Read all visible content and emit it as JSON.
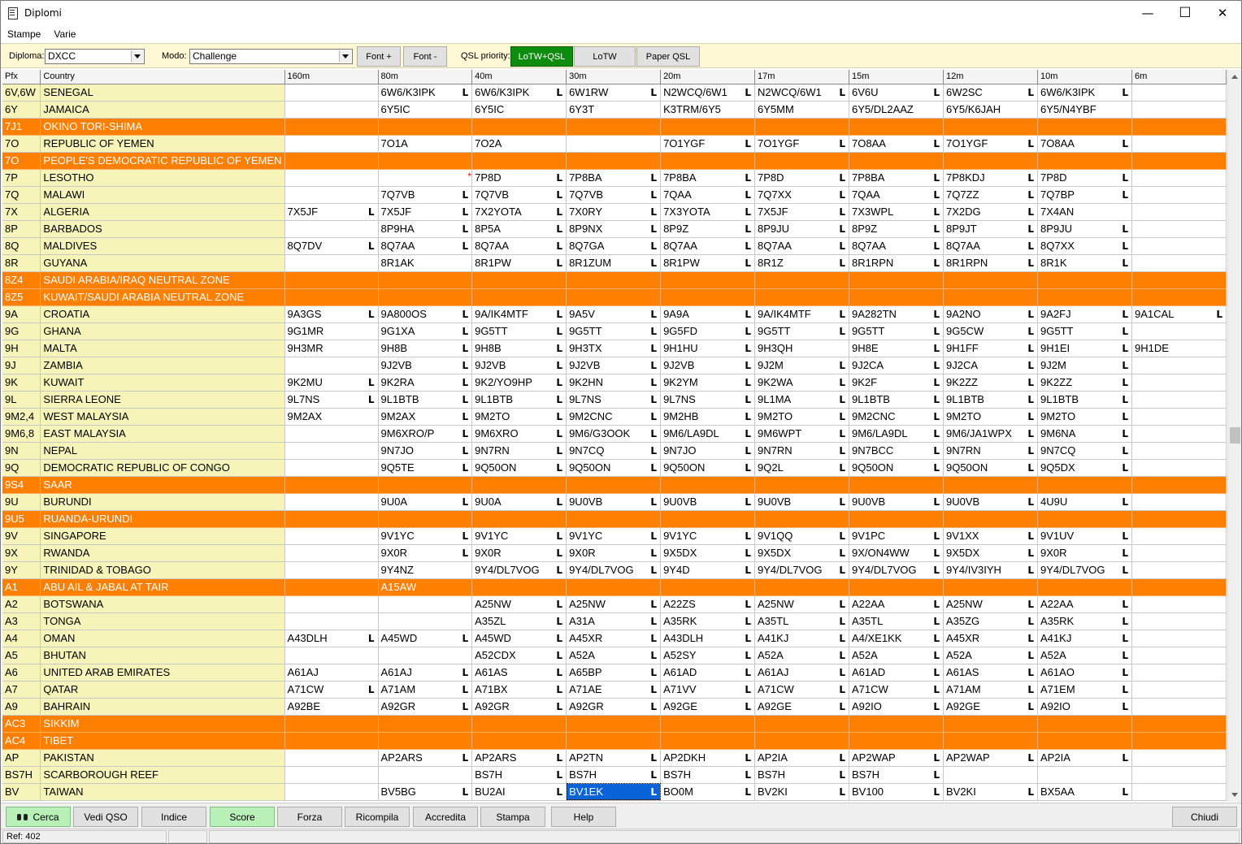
{
  "window": {
    "title": "Diplomi",
    "minimize": "—",
    "maximize": "☐",
    "close": "✕"
  },
  "menu": [
    "Stampe",
    "Varie"
  ],
  "toolbar": {
    "diploma_label": "Diploma:",
    "diploma_value": "DXCC",
    "modo_label": "Modo:",
    "modo_value": "Challenge",
    "font_plus": "Font +",
    "font_minus": "Font -",
    "qsl_label": "QSL priority:",
    "qsl_buttons": [
      "LoTW+QSL",
      "LoTW",
      "Paper QSL"
    ],
    "qsl_active": "LoTW+QSL"
  },
  "grid": {
    "columns": [
      "Pfx",
      "Country",
      "160m",
      "80m",
      "40m",
      "30m",
      "20m",
      "17m",
      "15m",
      "12m",
      "10m",
      "6m"
    ],
    "rows": [
      {
        "pfx": "6V,6W",
        "country": "SENEGAL",
        "cells": [
          "",
          "6W6/K3IPK|L",
          "6W6/K3IPK|L",
          "6W1RW|L",
          "N2WCQ/6W1|L",
          "N2WCQ/6W1|L",
          "6V6U|L",
          "6W2SC|L",
          "6W6/K3IPK|L",
          ""
        ]
      },
      {
        "pfx": "6Y",
        "country": "JAMAICA",
        "cells": [
          "",
          "6Y5IC",
          "6Y5IC",
          "6Y3T",
          "K3TRM/6Y5",
          "6Y5MM",
          "6Y5/DL2AAZ",
          "6Y5/K6JAH",
          "6Y5/N4YBF",
          ""
        ]
      },
      {
        "pfx": "7J1",
        "country": "OKINO TORI-SHIMA",
        "deleted": true,
        "cells": [
          "",
          "",
          "",
          "",
          "",
          "",
          "",
          "",
          "",
          ""
        ]
      },
      {
        "pfx": "7O",
        "country": "REPUBLIC OF YEMEN",
        "cells": [
          "",
          "7O1A",
          "7O2A",
          "",
          "7O1YGF|L",
          "7O1YGF|L",
          "7O8AA|L",
          "7O1YGF|L",
          "7O8AA|L",
          ""
        ]
      },
      {
        "pfx": "7O",
        "country": "PEOPLE'S DEMOCRATIC REPUBLIC OF YEMEN",
        "deleted": true,
        "cells": [
          "",
          "",
          "",
          "",
          "",
          "",
          "",
          "",
          "",
          ""
        ]
      },
      {
        "pfx": "7P",
        "country": "LESOTHO",
        "cells": [
          "",
          "|*",
          "7P8D|L",
          "7P8BA|L",
          "7P8BA|L",
          "7P8D|L",
          "7P8BA|L",
          "7P8KDJ|L",
          "7P8D|L",
          ""
        ]
      },
      {
        "pfx": "7Q",
        "country": "MALAWI",
        "cells": [
          "",
          "7Q7VB|L",
          "7Q7VB|L",
          "7Q7VB|L",
          "7QAA|L",
          "7Q7XX|L",
          "7QAA|L",
          "7Q7ZZ|L",
          "7Q7BP|L",
          ""
        ]
      },
      {
        "pfx": "7X",
        "country": "ALGERIA",
        "cells": [
          "7X5JF|L",
          "7X5JF|L",
          "7X2YOTA|L",
          "7X0RY|L",
          "7X3YOTA|L",
          "7X5JF|L",
          "7X3WPL|L",
          "7X2DG|L",
          "7X4AN",
          ""
        ]
      },
      {
        "pfx": "8P",
        "country": "BARBADOS",
        "cells": [
          "",
          "8P9HA|L",
          "8P5A|L",
          "8P9NX|L",
          "8P9Z|L",
          "8P9JU|L",
          "8P9Z|L",
          "8P9JT|L",
          "8P9JU|L",
          ""
        ]
      },
      {
        "pfx": "8Q",
        "country": "MALDIVES",
        "cells": [
          "8Q7DV|L",
          "8Q7AA|L",
          "8Q7AA|L",
          "8Q7GA|L",
          "8Q7AA|L",
          "8Q7AA|L",
          "8Q7AA|L",
          "8Q7AA|L",
          "8Q7XX|L",
          ""
        ]
      },
      {
        "pfx": "8R",
        "country": "GUYANA",
        "cells": [
          "",
          "8R1AK",
          "8R1PW|L",
          "8R1ZUM|L",
          "8R1PW|L",
          "8R1Z|L",
          "8R1RPN|L",
          "8R1RPN|L",
          "8R1K|L",
          ""
        ]
      },
      {
        "pfx": "8Z4",
        "country": "SAUDI ARABIA/IRAQ NEUTRAL ZONE",
        "deleted": true,
        "cells": [
          "",
          "",
          "",
          "",
          "",
          "",
          "",
          "",
          "",
          ""
        ]
      },
      {
        "pfx": "8Z5",
        "country": "KUWAIT/SAUDI ARABIA NEUTRAL ZONE",
        "deleted": true,
        "cells": [
          "",
          "",
          "",
          "",
          "",
          "",
          "",
          "",
          "",
          ""
        ]
      },
      {
        "pfx": "9A",
        "country": "CROATIA",
        "cells": [
          "9A3GS|L",
          "9A800OS|L",
          "9A/IK4MTF|L",
          "9A5V|L",
          "9A9A|L",
          "9A/IK4MTF|L",
          "9A282TN|L",
          "9A2NO|L",
          "9A2FJ|L",
          "9A1CAL|L"
        ]
      },
      {
        "pfx": "9G",
        "country": "GHANA",
        "cells": [
          "9G1MR",
          "9G1XA|L",
          "9G5TT|L",
          "9G5TT|L",
          "9G5FD|L",
          "9G5TT|L",
          "9G5TT|L",
          "9G5CW|L",
          "9G5TT|L",
          ""
        ]
      },
      {
        "pfx": "9H",
        "country": "MALTA",
        "cells": [
          "9H3MR",
          "9H8B|L",
          "9H8B|L",
          "9H3TX|L",
          "9H1HU|L",
          "9H3QH",
          "9H8E|L",
          "9H1FF|L",
          "9H1EI|L",
          "9H1DE"
        ]
      },
      {
        "pfx": "9J",
        "country": "ZAMBIA",
        "cells": [
          "",
          "9J2VB|L",
          "9J2VB|L",
          "9J2VB|L",
          "9J2VB|L",
          "9J2M|L",
          "9J2CA|L",
          "9J2CA|L",
          "9J2M|L",
          ""
        ]
      },
      {
        "pfx": "9K",
        "country": "KUWAIT",
        "cells": [
          "9K2MU|L",
          "9K2RA|L",
          "9K2/YO9HP|L",
          "9K2HN|L",
          "9K2YM|L",
          "9K2WA|L",
          "9K2F|L",
          "9K2ZZ|L",
          "9K2ZZ|L",
          ""
        ]
      },
      {
        "pfx": "9L",
        "country": "SIERRA LEONE",
        "cells": [
          "9L7NS|L",
          "9L1BTB|L",
          "9L1BTB|L",
          "9L7NS|L",
          "9L7NS|L",
          "9L1MA|L",
          "9L1BTB|L",
          "9L1BTB|L",
          "9L1BTB|L",
          ""
        ]
      },
      {
        "pfx": "9M2,4",
        "country": "WEST MALAYSIA",
        "cells": [
          "9M2AX",
          "9M2AX|L",
          "9M2TO|L",
          "9M2CNC|L",
          "9M2HB|L",
          "9M2TO|L",
          "9M2CNC|L",
          "9M2TO|L",
          "9M2TO|L",
          ""
        ]
      },
      {
        "pfx": "9M6,8",
        "country": "EAST MALAYSIA",
        "cells": [
          "",
          "9M6XRO/P|L",
          "9M6XRO|L",
          "9M6/G3OOK|L",
          "9M6/LA9DL|L",
          "9M6WPT|L",
          "9M6/LA9DL|L",
          "9M6/JA1WPX|L",
          "9M6NA|L",
          ""
        ]
      },
      {
        "pfx": "9N",
        "country": "NEPAL",
        "cells": [
          "",
          "9N7JO|L",
          "9N7RN|L",
          "9N7CQ|L",
          "9N7JO|L",
          "9N7RN|L",
          "9N7BCC|L",
          "9N7RN|L",
          "9N7CQ|L",
          ""
        ]
      },
      {
        "pfx": "9Q",
        "country": "DEMOCRATIC REPUBLIC OF CONGO",
        "cells": [
          "",
          "9Q5TE|L",
          "9Q50ON|L",
          "9Q50ON|L",
          "9Q50ON|L",
          "9Q2L|L",
          "9Q50ON|L",
          "9Q50ON|L",
          "9Q5DX|L",
          ""
        ]
      },
      {
        "pfx": "9S4",
        "country": "SAAR",
        "deleted": true,
        "cells": [
          "",
          "",
          "",
          "",
          "",
          "",
          "",
          "",
          "",
          ""
        ]
      },
      {
        "pfx": "9U",
        "country": "BURUNDI",
        "cells": [
          "",
          "9U0A|L",
          "9U0A|L",
          "9U0VB|L",
          "9U0VB|L",
          "9U0VB|L",
          "9U0VB|L",
          "9U0VB|L",
          "4U9U|L",
          ""
        ]
      },
      {
        "pfx": "9U5",
        "country": "RUANDA-URUNDI",
        "deleted": true,
        "cells": [
          "",
          "",
          "",
          "",
          "",
          "",
          "",
          "",
          "",
          ""
        ]
      },
      {
        "pfx": "9V",
        "country": "SINGAPORE",
        "cells": [
          "",
          "9V1YC|L",
          "9V1YC|L",
          "9V1YC|L",
          "9V1YC|L",
          "9V1QQ|L",
          "9V1PC|L",
          "9V1XX|L",
          "9V1UV|L",
          ""
        ]
      },
      {
        "pfx": "9X",
        "country": "RWANDA",
        "cells": [
          "",
          "9X0R|L",
          "9X0R|L",
          "9X0R|L",
          "9X5DX|L",
          "9X5DX|L",
          "9X/ON4WW|L",
          "9X5DX|L",
          "9X0R|L",
          ""
        ]
      },
      {
        "pfx": "9Y",
        "country": "TRINIDAD & TOBAGO",
        "cells": [
          "",
          "9Y4NZ",
          "9Y4/DL7VOG|L",
          "9Y4/DL7VOG|L",
          "9Y4D|L",
          "9Y4/DL7VOG|L",
          "9Y4/DL7VOG|L",
          "9Y4/IV3IYH|L",
          "9Y4/DL7VOG|L",
          ""
        ]
      },
      {
        "pfx": "A1",
        "country": "ABU AIL & JABAL AT TAIR",
        "deleted": true,
        "cells": [
          "",
          "A15AW",
          "",
          "",
          "",
          "",
          "",
          "",
          "",
          ""
        ]
      },
      {
        "pfx": "A2",
        "country": "BOTSWANA",
        "cells": [
          "",
          "",
          "A25NW|L",
          "A25NW|L",
          "A22ZS|L",
          "A25NW|L",
          "A22AA|L",
          "A25NW|L",
          "A22AA|L",
          ""
        ]
      },
      {
        "pfx": "A3",
        "country": "TONGA",
        "cells": [
          "",
          "",
          "A35ZL|L",
          "A31A|L",
          "A35RK|L",
          "A35TL|L",
          "A35TL|L",
          "A35ZG|L",
          "A35RK|L",
          ""
        ]
      },
      {
        "pfx": "A4",
        "country": "OMAN",
        "cells": [
          "A43DLH|L",
          "A45WD|L",
          "A45WD|L",
          "A45XR|L",
          "A43DLH|L",
          "A41KJ|L",
          "A4/XE1KK|L",
          "A45XR|L",
          "A41KJ|L",
          ""
        ]
      },
      {
        "pfx": "A5",
        "country": "BHUTAN",
        "cells": [
          "",
          "",
          "A52CDX|L",
          "A52A|L",
          "A52SY|L",
          "A52A|L",
          "A52A|L",
          "A52A|L",
          "A52A|L",
          ""
        ]
      },
      {
        "pfx": "A6",
        "country": "UNITED ARAB EMIRATES",
        "cells": [
          "A61AJ",
          "A61AJ|L",
          "A61AS|L",
          "A65BP|L",
          "A61AD|L",
          "A61AJ|L",
          "A61AD|L",
          "A61AS|L",
          "A61AO|L",
          ""
        ]
      },
      {
        "pfx": "A7",
        "country": "QATAR",
        "cells": [
          "A71CW|L",
          "A71AM|L",
          "A71BX|L",
          "A71AE|L",
          "A71VV|L",
          "A71CW|L",
          "A71CW|L",
          "A71AM|L",
          "A71EM|L",
          ""
        ]
      },
      {
        "pfx": "A9",
        "country": "BAHRAIN",
        "cells": [
          "A92BE",
          "A92GR|L",
          "A92GR|L",
          "A92GR|L",
          "A92GE|L",
          "A92GE|L",
          "A92IO|L",
          "A92GE|L",
          "A92IO|L",
          ""
        ]
      },
      {
        "pfx": "AC3",
        "country": "SIKKIM",
        "deleted": true,
        "cells": [
          "",
          "",
          "",
          "",
          "",
          "",
          "",
          "",
          "",
          ""
        ]
      },
      {
        "pfx": "AC4",
        "country": "TIBET",
        "deleted": true,
        "cells": [
          "",
          "",
          "",
          "",
          "",
          "",
          "",
          "",
          "",
          ""
        ]
      },
      {
        "pfx": "AP",
        "country": "PAKISTAN",
        "cells": [
          "",
          "AP2ARS|L",
          "AP2ARS|L",
          "AP2TN|L",
          "AP2DKH|L",
          "AP2IA|L",
          "AP2WAP|L",
          "AP2WAP|L",
          "AP2IA|L",
          ""
        ]
      },
      {
        "pfx": "BS7H",
        "country": "SCARBOROUGH REEF",
        "cells": [
          "",
          "",
          "BS7H|L",
          "BS7H|L",
          "BS7H|L",
          "BS7H|L",
          "BS7H|L",
          "",
          "",
          ""
        ]
      },
      {
        "pfx": "BV",
        "country": "TAIWAN",
        "cells": [
          "",
          "BV5BG|L",
          "BU2AI|L",
          "BV1EK|L|sel",
          "BO0M|L",
          "BV2KI|L",
          "BV100|L",
          "BV2KI|L",
          "BX5AA|L",
          ""
        ]
      }
    ]
  },
  "bottom_buttons": [
    "Cerca",
    "Vedi QSO",
    "Indice",
    "Score",
    "Forza",
    "Ricompila",
    "Accredita",
    "Stampa",
    "Help"
  ],
  "close_button": "Chiudi",
  "status": {
    "ref": "Ref: 402"
  },
  "colors": {
    "deleted_row": "#ff8000",
    "country_bg": "#f6f4b8",
    "toolbar_bg": "#fff8d4",
    "qsl_active": "#0e8c0e",
    "selection": "#0a64d8"
  }
}
